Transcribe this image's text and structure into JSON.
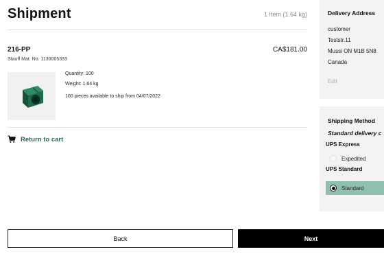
{
  "header": {
    "title": "Shipment",
    "item_count": "1 Item (1.64 kg)"
  },
  "product": {
    "name": "216-PP",
    "price": "CA$181.00",
    "mat_no": "Stauff Mat. No. 1130005333",
    "quantity": "Quantity: 100",
    "weight": "Weight: 1.64 kg",
    "availability": "100 pieces available to ship from 04/07/2022",
    "thumbnail_icon": "pipe-clamp-image",
    "accent_color": "#1e6f4f"
  },
  "return_link": {
    "label": "Return to cart",
    "icon": "cart-icon"
  },
  "delivery_address": {
    "title": "Delivery Address",
    "lines": [
      "customer",
      "Teststr.11",
      "Mussi ON M1B 5N8",
      "Canada"
    ],
    "edit_label": "Edit"
  },
  "shipping_method": {
    "title": "Shipping Method",
    "subtitle": "Standard delivery c",
    "groups": [
      {
        "name": "UPS Express",
        "option": "Expedited",
        "selected": false
      },
      {
        "name": "UPS Standard",
        "option": "Standard",
        "selected": true
      }
    ],
    "selected_color": "#8fbfb0"
  },
  "footer": {
    "back_label": "Back",
    "next_label": "Next"
  }
}
